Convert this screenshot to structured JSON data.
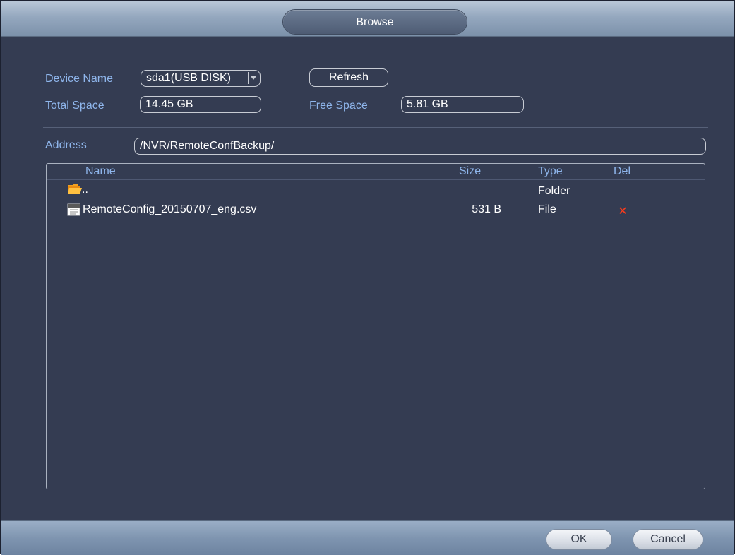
{
  "window": {
    "title": "Browse"
  },
  "device": {
    "name_label": "Device Name",
    "name_value": "sda1(USB DISK)",
    "refresh_label": "Refresh",
    "total_label": "Total Space",
    "total_value": "14.45 GB",
    "free_label": "Free Space",
    "free_value": "5.81 GB"
  },
  "address": {
    "label": "Address",
    "value": "/NVR/RemoteConfBackup/"
  },
  "file_table": {
    "columns": [
      "Name",
      "Size",
      "Type",
      "Del"
    ],
    "rows": [
      {
        "icon": "folder-icon",
        "name": "..",
        "size": "",
        "type": "Folder",
        "del": false
      },
      {
        "icon": "file-icon",
        "name": "RemoteConfig_20150707_eng.csv",
        "size": "531 B",
        "type": "File",
        "del": true
      }
    ]
  },
  "footer": {
    "ok_label": "OK",
    "cancel_label": "Cancel"
  },
  "colors": {
    "background": "#343c52",
    "label": "#8fb6ec",
    "delete": "#ff3b1a"
  }
}
